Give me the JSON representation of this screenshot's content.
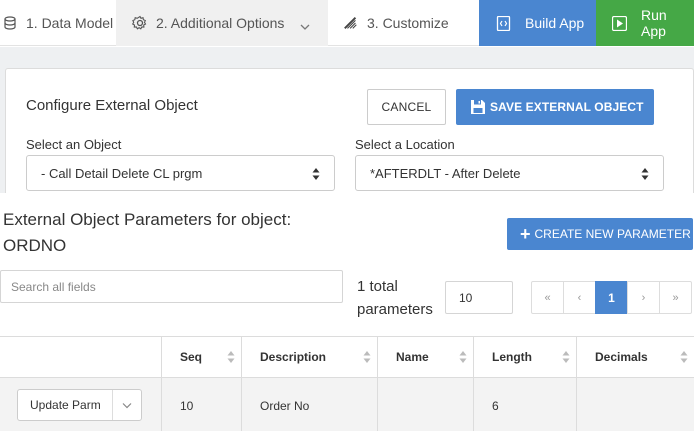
{
  "tabs": [
    {
      "label": "1. Data Model",
      "icon": "database-icon"
    },
    {
      "label": "2. Additional Options",
      "icon": "gear-icon"
    },
    {
      "label": "3. Customize",
      "icon": "magic-wand-icon"
    }
  ],
  "actions": {
    "build": {
      "label": "Build App",
      "icon": "code-file-icon"
    },
    "run": {
      "label": "Run App",
      "icon": "play-icon"
    }
  },
  "colors": {
    "primary": "#4a86d0",
    "success": "#45a846"
  },
  "card": {
    "title": "Configure External Object",
    "cancel_label": "CANCEL",
    "save_label": "SAVE EXTERNAL OBJECT",
    "object_label": "Select an Object",
    "object_value": "- Call Detail Delete CL prgm",
    "location_label": "Select a Location",
    "location_value": "*AFTERDLT - After Delete"
  },
  "params": {
    "title_line1": "External Object Parameters for object:",
    "title_line2": "ORDNO",
    "create_label": "CREATE NEW PARAMETER",
    "search_placeholder": "Search all fields",
    "total_line1": "1 total",
    "total_line2": "parameters",
    "page_size": "10",
    "pager": [
      "«",
      "‹",
      "1",
      "›",
      "»"
    ],
    "current_page": "1"
  },
  "table": {
    "columns": [
      "",
      "Seq",
      "Description",
      "Name",
      "Length",
      "Decimals"
    ],
    "rows": [
      {
        "action": "Update Parm",
        "seq": "10",
        "description": "Order No",
        "name": "",
        "length": "6",
        "decimals": ""
      }
    ]
  }
}
